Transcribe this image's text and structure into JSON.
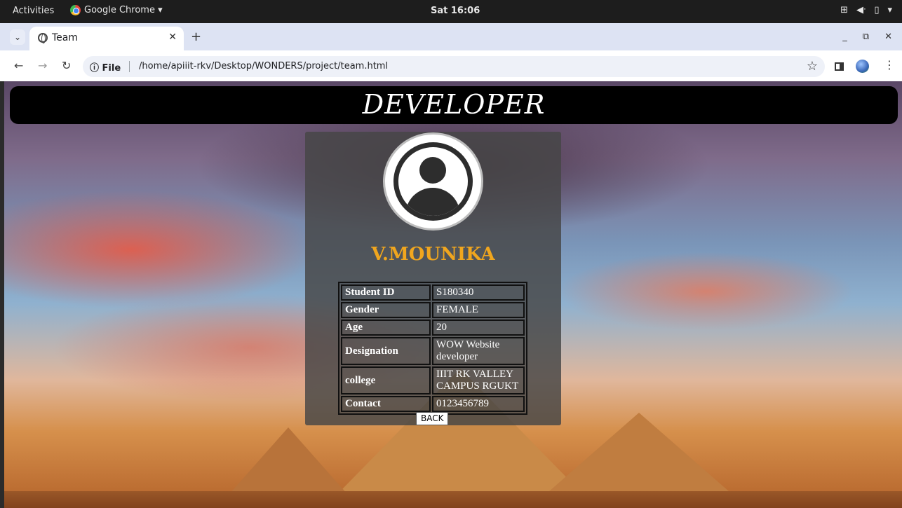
{
  "system_bar": {
    "activities": "Activities",
    "app_name": "Google Chrome ▾",
    "clock": "Sat 16:06"
  },
  "browser": {
    "tab_title": "Team",
    "url_prefix": "File",
    "url": "/home/apiiit-rkv/Desktop/WONDERS/project/team.html"
  },
  "page": {
    "heading": "DEVELOPER",
    "name": "V.MOUNIKA",
    "details": [
      {
        "label": "Student ID",
        "value": "S180340"
      },
      {
        "label": "Gender",
        "value": "FEMALE"
      },
      {
        "label": "Age",
        "value": "20"
      },
      {
        "label": "Designation",
        "value": "WOW Website developer"
      },
      {
        "label": "college",
        "value": "IIIT RK VALLEY CAMPUS RGUKT"
      },
      {
        "label": "Contact",
        "value": "0123456789"
      }
    ],
    "back_label": "BACK"
  }
}
